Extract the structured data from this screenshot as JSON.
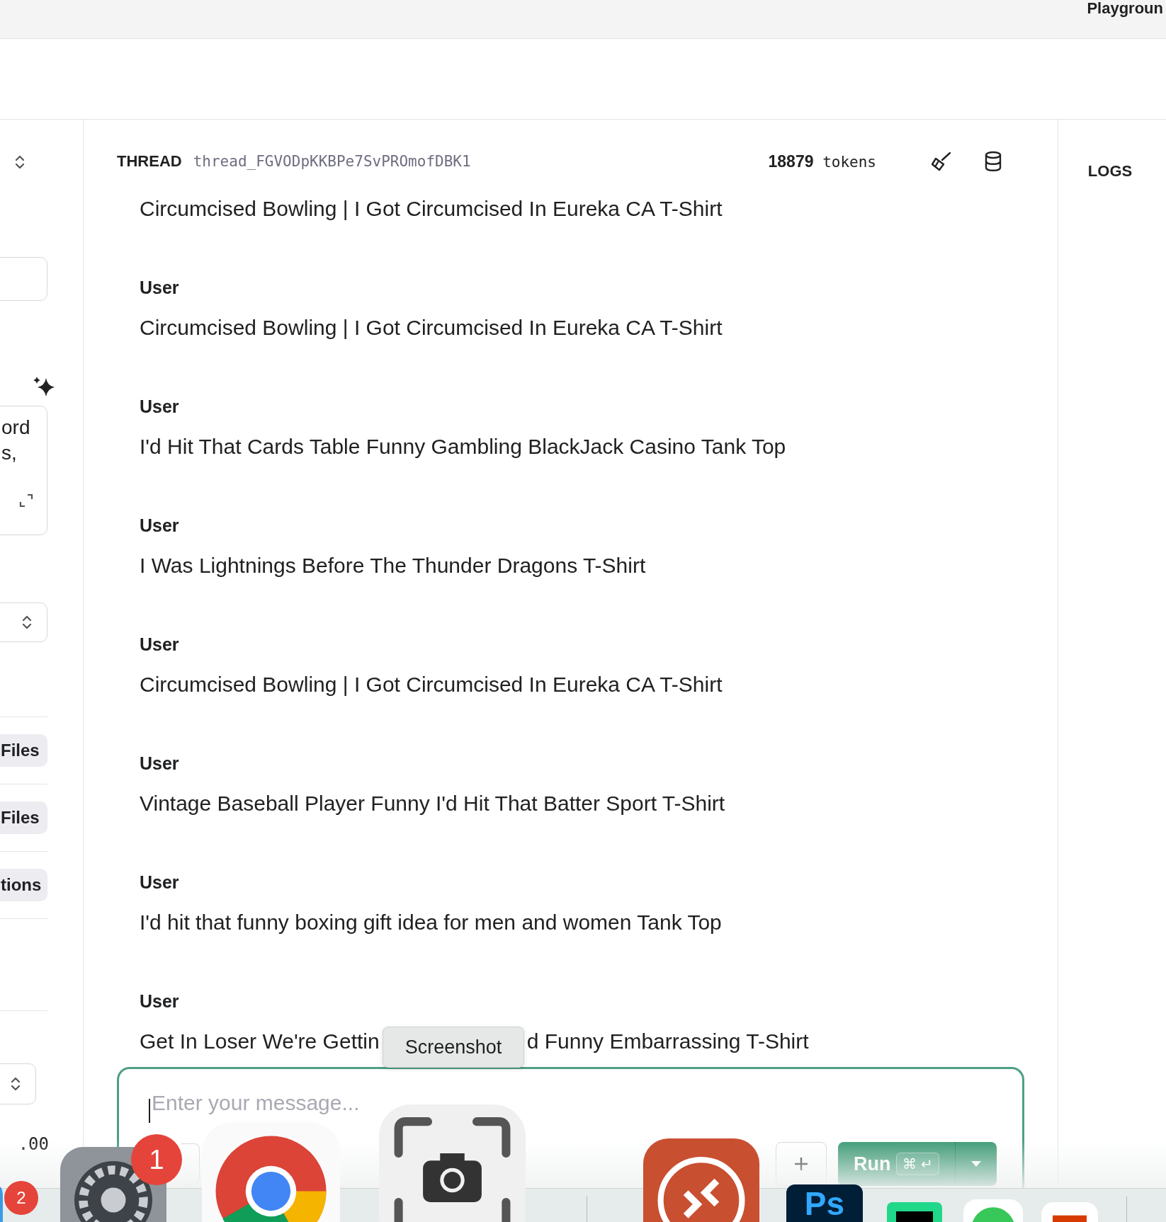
{
  "top_bar": {
    "title": "Playgroun"
  },
  "left_panel": {
    "items": [
      {
        "kind": "chevron"
      },
      {
        "kind": "input"
      },
      {
        "kind": "sparkle"
      },
      {
        "kind": "textarea",
        "lines": [
          "ord",
          "s,"
        ]
      },
      {
        "kind": "select"
      },
      {
        "kind": "divider"
      },
      {
        "kind": "pill",
        "label": "Files"
      },
      {
        "kind": "divider"
      },
      {
        "kind": "pill",
        "label": "Files"
      },
      {
        "kind": "divider"
      },
      {
        "kind": "pill",
        "label": "tions"
      },
      {
        "kind": "divider"
      },
      {
        "kind": "divider"
      },
      {
        "kind": "select"
      },
      {
        "kind": "value",
        "text": ".00"
      }
    ]
  },
  "thread": {
    "label": "THREAD",
    "id": "thread_FGVODpKKBPe7SvPROmofDBK1",
    "token_count": "18879",
    "token_unit": "tokens"
  },
  "messages": [
    {
      "parts": [
        "Circumcised Bowling | I Got Circumcised In Eureka CA T-Shirt"
      ]
    },
    {
      "role": "User",
      "parts": [
        "Circumcised Bowling | I Got Circumcised In Eureka CA T-Shirt"
      ]
    },
    {
      "role": "User",
      "parts": [
        "I'd Hit That Cards Table Funny Gambling BlackJack Casino Tank Top"
      ]
    },
    {
      "role": "User",
      "parts": [
        "I Was Lightnings Before The Thunder Dragons T-Shirt"
      ]
    },
    {
      "role": "User",
      "parts": [
        "Circumcised Bowling | I Got Circumcised In Eureka CA T-Shirt"
      ]
    },
    {
      "role": "User",
      "parts": [
        "Vintage Baseball Player Funny I'd Hit That Batter Sport T-Shirt"
      ]
    },
    {
      "role": "User",
      "parts": [
        "I'd hit that funny boxing gift idea for men and women Tank Top"
      ]
    },
    {
      "role": "User",
      "parts": [
        "Get In Loser We're Gettin",
        "d Funny Embarrassing T-Shirt"
      ]
    }
  ],
  "right_panel": {
    "title": "LOGS"
  },
  "composer": {
    "placeholder": "Enter your message...",
    "run_label": "Run",
    "shortcut": [
      "⌘",
      "↵"
    ]
  },
  "dock": {
    "tooltip": "Screenshot",
    "apps": [
      {
        "kind": "finder",
        "badge": "2"
      },
      {
        "kind": "settings",
        "badge": "1"
      },
      {
        "kind": "chrome"
      },
      {
        "kind": "screenshot"
      },
      {
        "kind": "remote"
      },
      {
        "kind": "photoshop",
        "label": "Ps"
      },
      {
        "kind": "pycharm"
      },
      {
        "kind": "messages"
      },
      {
        "kind": "office"
      }
    ]
  }
}
